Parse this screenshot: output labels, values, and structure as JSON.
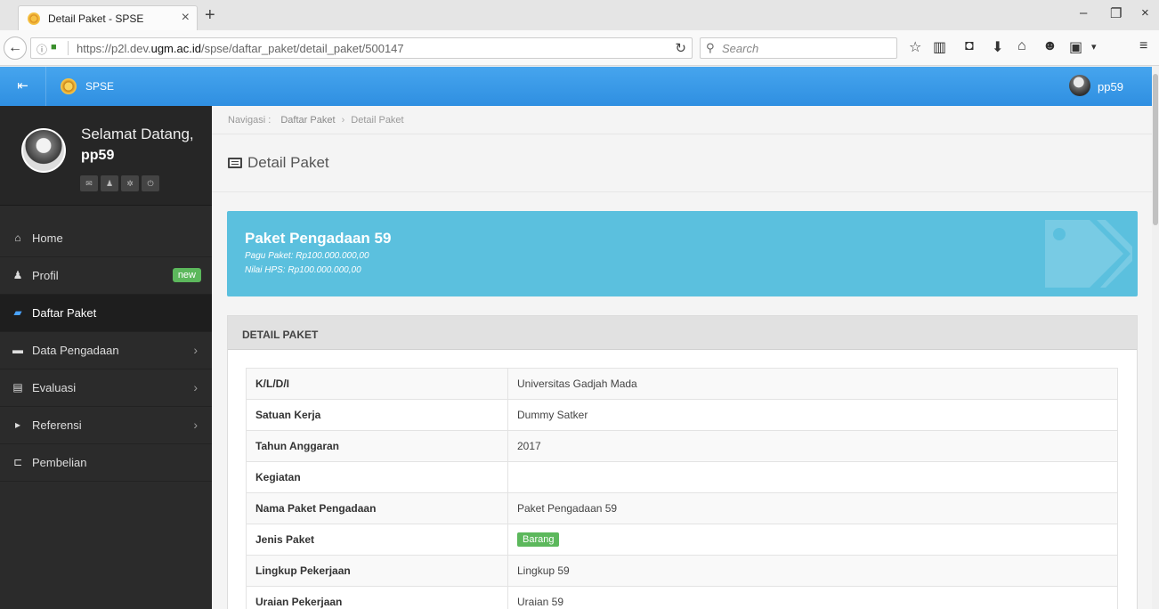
{
  "browser": {
    "tab_title": "Detail Paket - SPSE",
    "tab_close": "×",
    "new_tab": "+",
    "url_host_prefix": "https://p2l.dev.",
    "url_host_bold": "ugm.ac.id",
    "url_path": "/spse/daftar_paket/detail_paket/500147",
    "search_placeholder": "Search",
    "window_controls": [
      "–",
      "❐",
      "×"
    ],
    "toolbar_icons": [
      "star-icon",
      "reading-list-icon",
      "pocket-icon",
      "download-icon",
      "home-icon",
      "chat-icon",
      "addon-icon",
      "menu-icon"
    ]
  },
  "header": {
    "brand": "SPSE",
    "user": "pp59"
  },
  "sidebar": {
    "welcome": "Selamat Datang,",
    "username": "pp59",
    "items": [
      {
        "label": "Home",
        "icon": "home-icon",
        "glyph": "⌂"
      },
      {
        "label": "Profil",
        "icon": "user-icon",
        "glyph": "♟",
        "badge": "new"
      },
      {
        "label": "Daftar Paket",
        "icon": "book-icon",
        "glyph": "▰"
      },
      {
        "label": "Data Pengadaan",
        "icon": "briefcase-icon",
        "glyph": "▬",
        "arrow": "›"
      },
      {
        "label": "Evaluasi",
        "icon": "file-icon",
        "glyph": "▤",
        "arrow": "›"
      },
      {
        "label": "Referensi",
        "icon": "caret-right-icon",
        "glyph": "▸",
        "arrow": "›"
      },
      {
        "label": "Pembelian",
        "icon": "cart-icon",
        "glyph": "⊏"
      }
    ]
  },
  "breadcrumb": {
    "label": "Navigasi :",
    "items": [
      "Daftar Paket",
      "Detail Paket"
    ],
    "separator": "›"
  },
  "page_title": "Detail Paket",
  "info": {
    "name": "Paket Pengadaan 59",
    "pagu": "Pagu Paket: Rp100.000.000,00",
    "hps": "Nilai HPS: Rp100.000.000,00"
  },
  "detail": {
    "heading": "DETAIL PAKET",
    "rows": [
      {
        "key": "K/L/D/I",
        "value": "Universitas Gadjah Mada"
      },
      {
        "key": "Satuan Kerja",
        "value": "Dummy Satker"
      },
      {
        "key": "Tahun Anggaran",
        "value": "2017"
      },
      {
        "key": "Kegiatan",
        "value": ""
      },
      {
        "key": "Nama Paket Pengadaan",
        "value": "Paket Pengadaan 59"
      },
      {
        "key": "Jenis Paket",
        "value": "Barang",
        "badge": true
      },
      {
        "key": "Lingkup Pekerjaan",
        "value": "Lingkup 59"
      },
      {
        "key": "Uraian Pekerjaan",
        "value": "Uraian 59"
      }
    ]
  },
  "colors": {
    "header_blue": "#2f8fe1",
    "info_panel": "#5bc0de",
    "sidebar_bg": "#2b2b2b",
    "badge_green": "#5cb85c"
  }
}
